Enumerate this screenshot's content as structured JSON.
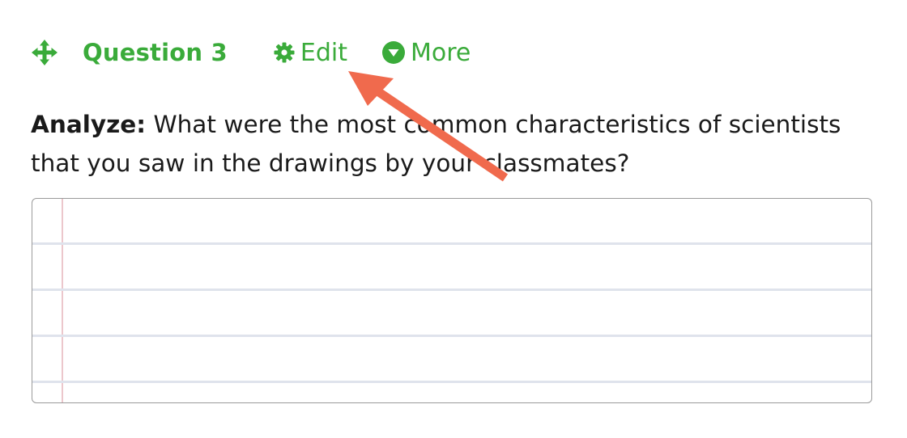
{
  "question": {
    "title": "Question 3",
    "edit_label": "Edit",
    "more_label": "More"
  },
  "prompt": {
    "lead": "Analyze:",
    "text": " What were the most common characteristics of scientists that you saw in the drawings by your classmates?"
  },
  "answer": {
    "value": ""
  },
  "colors": {
    "accent_green": "#3aab3a",
    "annotation_arrow": "#f06a4d",
    "notebook_margin": "#ecc7cc",
    "notebook_rule": "#dfe3ec"
  },
  "icons": {
    "move": "move-arrows-icon",
    "edit": "gear-icon",
    "more": "caret-down-circle-icon"
  }
}
